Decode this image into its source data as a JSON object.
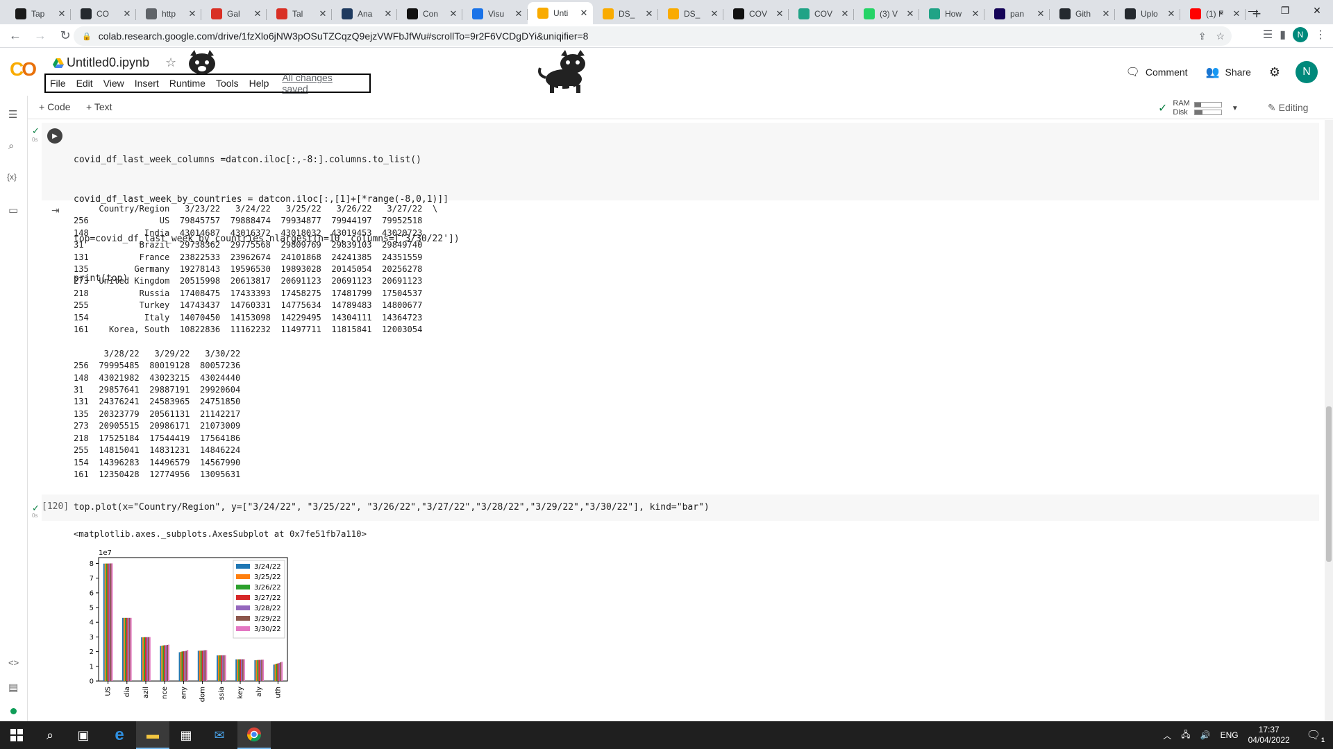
{
  "browser": {
    "tabs": [
      {
        "label": "Tap",
        "fav": "Bb",
        "color": "#1a1a1a"
      },
      {
        "label": "CO",
        "fav": "gh",
        "color": "#24292e"
      },
      {
        "label": "http",
        "fav": "globe",
        "color": "#5f6368"
      },
      {
        "label": "Gal",
        "fav": "M",
        "color": "#d93025"
      },
      {
        "label": "Tal",
        "fav": "M",
        "color": "#d93025"
      },
      {
        "label": "Ana",
        "fav": "gds",
        "color": "#1e3a5f"
      },
      {
        "label": "Con",
        "fav": "P",
        "color": "#111"
      },
      {
        "label": "Visu",
        "fav": "chart",
        "color": "#1a73e8"
      },
      {
        "label": "Unti",
        "fav": "CO",
        "color": "#f9ab00",
        "active": true
      },
      {
        "label": "DS_",
        "fav": "CO",
        "color": "#f9ab00"
      },
      {
        "label": "DS_",
        "fav": "CO",
        "color": "#f9ab00"
      },
      {
        "label": "COV",
        "fav": "Me",
        "color": "#111"
      },
      {
        "label": "COV",
        "fav": "oo",
        "color": "#20a386"
      },
      {
        "label": "(3) V",
        "fav": "3",
        "color": "#25d366"
      },
      {
        "label": "How",
        "fav": "oo",
        "color": "#20a386"
      },
      {
        "label": "pan",
        "fav": "pd",
        "color": "#150458"
      },
      {
        "label": "Gith",
        "fav": "gh",
        "color": "#24292e"
      },
      {
        "label": "Uplo",
        "fav": "gh",
        "color": "#24292e"
      },
      {
        "label": "(1) F",
        "fav": "yt",
        "color": "#ff0000"
      }
    ],
    "url": "colab.research.google.com/drive/1fzXlo6jNW3pOSuTZCqzQ9ejzVWFbJfWu#scrollTo=9r2F6VCDgDYi&uniqifier=8",
    "profile_initial": "N"
  },
  "colab": {
    "title": "Untitled0.ipynb",
    "menu": [
      "File",
      "Edit",
      "View",
      "Insert",
      "Runtime",
      "Tools",
      "Help"
    ],
    "saved_status": "All changes saved",
    "comment_label": "Comment",
    "share_label": "Share",
    "user_initial": "N",
    "add_code": "+ Code",
    "add_text": "+ Text",
    "ram_label": "RAM",
    "disk_label": "Disk",
    "ram_usage": 0.25,
    "disk_usage": 0.3,
    "editing_label": "Editing"
  },
  "cells": {
    "cell1_time": "0s",
    "cell1_code": [
      "covid_df_last_week_columns =datcon.iloc[:,-8:].columns.to_list()",
      "covid_df_last_week_by_countries = datcon.iloc[:,[1]+[*range(-8,0,1)]]",
      "top=covid_df_last_week_by_countries.nlargest(n=10, columns=['3/30/22'])",
      "print(top)"
    ],
    "cell1_output": [
      "     Country/Region   3/23/22   3/24/22   3/25/22   3/26/22   3/27/22  \\",
      "256              US  79845757  79888474  79934877  79944197  79952518",
      "148           India  43014687  43016372  43018032  43019453  43020723",
      "31           Brazil  29738362  29775568  29809769  29839103  29849740",
      "131          France  23822533  23962674  24101868  24241385  24351559",
      "135         Germany  19278143  19596530  19893028  20145054  20256278",
      "273  United Kingdom  20515998  20613817  20691123  20691123  20691123",
      "218          Russia  17408475  17433393  17458275  17481799  17504537",
      "255          Turkey  14743437  14760331  14775634  14789483  14800677",
      "154           Italy  14070450  14153098  14229495  14304111  14364723",
      "161    Korea, South  10822836  11162232  11497711  11815841  12003054",
      "",
      "      3/28/22   3/29/22   3/30/22",
      "256  79995485  80019128  80057236",
      "148  43021982  43023215  43024440",
      "31   29857641  29887191  29920604",
      "131  24376241  24583965  24751850",
      "135  20323779  20561131  21142217",
      "273  20905515  20986171  21073009",
      "218  17525184  17544419  17564186",
      "255  14815041  14831231  14846224",
      "154  14396283  14496579  14567990",
      "161  12350428  12774956  13095631"
    ],
    "cell2_number": "[120]",
    "cell2_time": "0s",
    "cell2_code": "top.plot(x=\"Country/Region\", y=[\"3/24/22\", \"3/25/22\", \"3/26/22\",\"3/27/22\",\"3/28/22\",\"3/29/22\",\"3/30/22\"], kind=\"bar\")",
    "cell2_output": "<matplotlib.axes._subplots.AxesSubplot at 0x7fe51fb7a110>"
  },
  "chart_data": {
    "type": "bar",
    "categories": [
      "US",
      "India",
      "Brazil",
      "France",
      "Germany",
      "United Kingdom",
      "Russia",
      "Turkey",
      "Italy",
      "Korea, South"
    ],
    "visible_tick_labels": [
      "US",
      "dia",
      "azil",
      "nce",
      "any",
      "dom",
      "ssia",
      "key",
      "aly",
      "uth"
    ],
    "series": [
      {
        "name": "3/24/22",
        "color": "#1f77b4",
        "values": [
          79888474,
          43016372,
          29775568,
          23962674,
          19596530,
          20613817,
          17433393,
          14760331,
          14153098,
          11162232
        ]
      },
      {
        "name": "3/25/22",
        "color": "#ff7f0e",
        "values": [
          79934877,
          43018032,
          29809769,
          24101868,
          19893028,
          20691123,
          17458275,
          14775634,
          14229495,
          11497711
        ]
      },
      {
        "name": "3/26/22",
        "color": "#2ca02c",
        "values": [
          79944197,
          43019453,
          29839103,
          24241385,
          20145054,
          20691123,
          17481799,
          14789483,
          14304111,
          11815841
        ]
      },
      {
        "name": "3/27/22",
        "color": "#d62728",
        "values": [
          79952518,
          43020723,
          29849740,
          24351559,
          20256278,
          20691123,
          17504537,
          14800677,
          14364723,
          12003054
        ]
      },
      {
        "name": "3/28/22",
        "color": "#9467bd",
        "values": [
          79995485,
          43021982,
          29857641,
          24376241,
          20323779,
          20905515,
          17525184,
          14815041,
          14396283,
          12350428
        ]
      },
      {
        "name": "3/29/22",
        "color": "#8c564b",
        "values": [
          80019128,
          43023215,
          29887191,
          24583965,
          20561131,
          20986171,
          17544419,
          14831231,
          14496579,
          12774956
        ]
      },
      {
        "name": "3/30/22",
        "color": "#e377c2",
        "values": [
          80057236,
          43024440,
          29920604,
          24751850,
          21142217,
          21073009,
          17564186,
          14846224,
          14567990,
          13095631
        ]
      }
    ],
    "ylim": [
      0,
      84000000
    ],
    "yticks": [
      0,
      10000000,
      20000000,
      30000000,
      40000000,
      50000000,
      60000000,
      70000000,
      80000000
    ],
    "ytick_labels": [
      "0",
      "1",
      "2",
      "3",
      "4",
      "5",
      "6",
      "7",
      "8"
    ],
    "offset_text": "1e7",
    "legend_position": "upper-right"
  },
  "taskbar": {
    "language": "ENG",
    "time": "17:37",
    "date": "04/04/2022",
    "notification_count": "1"
  }
}
